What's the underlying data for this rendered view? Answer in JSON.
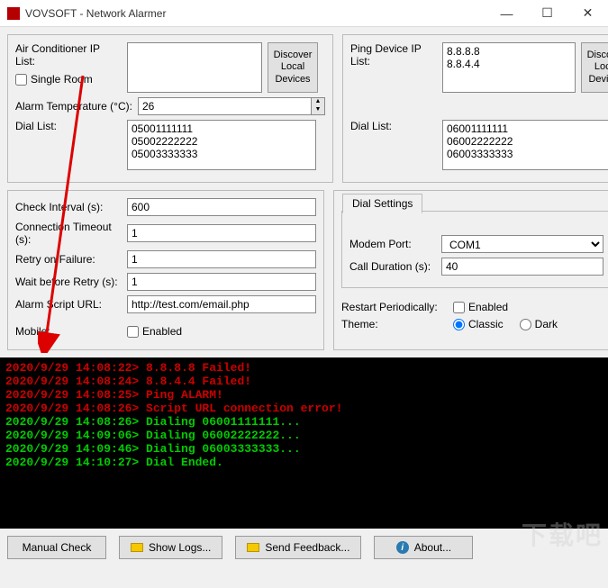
{
  "window": {
    "title": "VOVSOFT - Network Alarmer",
    "min": "—",
    "max": "☐",
    "close": "✕"
  },
  "left_panel": {
    "ac_ip_list_label": "Air Conditioner IP List:",
    "ac_ip_list_value": "",
    "single_room_label": "Single Room",
    "discover_label": "Discover\nLocal\nDevices",
    "alarm_temp_label": "Alarm Temperature (°C):",
    "alarm_temp_value": "26",
    "dial_list_label": "Dial List:",
    "dial_list_value": "05001111111\n05002222222\n05003333333"
  },
  "right_panel": {
    "ping_label": "Ping Device IP List:",
    "ping_value": "8.8.8.8\n8.8.4.4",
    "discover_label": "Discover\nLocal\nDevices",
    "dial_list_label": "Dial List:",
    "dial_list_value": "06001111111\n06002222222\n06003333333"
  },
  "settings_left": {
    "check_interval_label": "Check Interval (s):",
    "check_interval_value": "600",
    "conn_timeout_label": "Connection Timeout (s):",
    "conn_timeout_value": "1",
    "retry_label": "Retry on Failure:",
    "retry_value": "1",
    "wait_retry_label": "Wait before Retry (s):",
    "wait_retry_value": "1",
    "script_url_label": "Alarm Script URL:",
    "script_url_value": "http://test.com/email.php",
    "mobile_label": "Mobile:",
    "mobile_enabled_label": "Enabled"
  },
  "settings_right": {
    "dial_settings_label": "Dial Settings",
    "modem_port_label": "Modem Port:",
    "modem_port_value": "COM1",
    "call_dur_label": "Call Duration (s):",
    "call_dur_value": "40",
    "restart_label": "Restart Periodically:",
    "restart_enabled_label": "Enabled",
    "theme_label": "Theme:",
    "theme_classic": "Classic",
    "theme_dark": "Dark"
  },
  "console_lines": [
    {
      "cls": "red",
      "text": "2020/9/29 14:08:22> 8.8.8.8 Failed!"
    },
    {
      "cls": "red",
      "text": "2020/9/29 14:08:24> 8.8.4.4 Failed!"
    },
    {
      "cls": "red",
      "text": "2020/9/29 14:08:25> Ping ALARM!"
    },
    {
      "cls": "red",
      "text": "2020/9/29 14:08:26> Script URL connection error!"
    },
    {
      "cls": "green",
      "text": "2020/9/29 14:08:26> Dialing 06001111111..."
    },
    {
      "cls": "green",
      "text": "2020/9/29 14:09:06> Dialing 06002222222..."
    },
    {
      "cls": "green",
      "text": "2020/9/29 14:09:46> Dialing 06003333333..."
    },
    {
      "cls": "green",
      "text": "2020/9/29 14:10:27> Dial Ended."
    }
  ],
  "buttons": {
    "manual_check": "Manual Check",
    "show_logs": "Show Logs...",
    "send_feedback": "Send Feedback...",
    "about": "About..."
  },
  "watermark": "下载吧"
}
